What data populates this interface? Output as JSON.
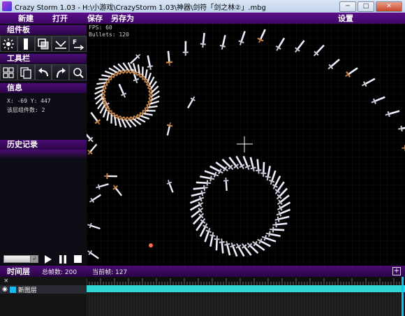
{
  "window": {
    "title": "Crazy Storm 1.03 - H:\\小游戏\\CrazyStorm 1.03\\神器\\剑符「剑之林②」.mbg",
    "minimize": "─",
    "maximize": "□",
    "close": "✕"
  },
  "menu": {
    "new": "新建",
    "open": "打开",
    "save": "保存",
    "save_as": "另存为",
    "settings": "设置"
  },
  "panels": {
    "components": "组件板",
    "toolbar": "工具栏",
    "info": "信息",
    "history": "历史记录"
  },
  "info": {
    "coords": "X: -69  Y: 447",
    "layer_count": "该层组件数: 2"
  },
  "hud": {
    "fps": "FPS: 60",
    "bullets": "Bullets: 120"
  },
  "timeline": {
    "title": "时间层",
    "total_frames": "总帧数: 200",
    "current_frame": "当前帧: 127",
    "add": "+",
    "close": "×",
    "layer": {
      "name": "新图层",
      "color": "#18b8f0"
    }
  },
  "colors": {
    "menu_bg": "#4a0c74",
    "track": "#2fd6d6"
  },
  "icons": {
    "components": [
      "emitter-icon",
      "laser-icon",
      "mask-icon",
      "rebound-icon",
      "force-field-icon"
    ],
    "tools": [
      "grid-icon",
      "copy-icon",
      "undo-icon",
      "redo-icon",
      "zoom-icon"
    ]
  }
}
